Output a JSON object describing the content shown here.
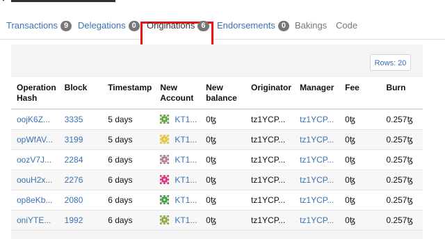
{
  "tabs": [
    {
      "label": "Transactions",
      "count": "9"
    },
    {
      "label": "Delegations",
      "count": "0"
    },
    {
      "label": "Originations",
      "count": "6"
    },
    {
      "label": "Endorsements",
      "count": "0"
    },
    {
      "label": "Bakings"
    },
    {
      "label": "Code"
    }
  ],
  "rows_button": "Rows: 20",
  "columns": [
    "Operation Hash",
    "Block",
    "Timestamp",
    "New Account",
    "New balance",
    "Originator",
    "Manager",
    "Fee",
    "Burn"
  ],
  "rows": [
    {
      "hash": "oojK6Z...",
      "block": "3335",
      "time": "5 days",
      "account": "KT1...",
      "balance": "0ꜩ",
      "originator": "tz1YCP...",
      "manager": "tz1YCP...",
      "fee": "0ꜩ",
      "burn": "0.257ꜩ",
      "icon_color": "#5aa23a"
    },
    {
      "hash": "opWfAV...",
      "block": "3199",
      "time": "5 days",
      "account": "KT1...",
      "balance": "0ꜩ",
      "originator": "tz1YCP...",
      "manager": "tz1YCP...",
      "fee": "0ꜩ",
      "burn": "0.257ꜩ",
      "icon_color": "#e6c22b"
    },
    {
      "hash": "oozV7J...",
      "block": "2284",
      "time": "6 days",
      "account": "KT1...",
      "balance": "0ꜩ",
      "originator": "tz1YCP...",
      "manager": "tz1YCP...",
      "fee": "0ꜩ",
      "burn": "0.257ꜩ",
      "icon_color": "#b07a8a"
    },
    {
      "hash": "oouH2x...",
      "block": "2276",
      "time": "6 days",
      "account": "KT1...",
      "balance": "0ꜩ",
      "originator": "tz1YCP...",
      "manager": "tz1YCP...",
      "fee": "0ꜩ",
      "burn": "0.257ꜩ",
      "icon_color": "#e0287a"
    },
    {
      "hash": "op8eKb...",
      "block": "2080",
      "time": "6 days",
      "account": "KT1...",
      "balance": "0ꜩ",
      "originator": "tz1YCP...",
      "manager": "tz1YCP...",
      "fee": "0ꜩ",
      "burn": "0.257ꜩ",
      "icon_color": "#3f9a3a"
    },
    {
      "hash": "oniYTE...",
      "block": "1992",
      "time": "6 days",
      "account": "KT1...",
      "balance": "0ꜩ",
      "originator": "tz1YCP...",
      "manager": "tz1YCP...",
      "fee": "0ꜩ",
      "burn": "0.257ꜩ",
      "icon_color": "#8aa83a"
    }
  ]
}
